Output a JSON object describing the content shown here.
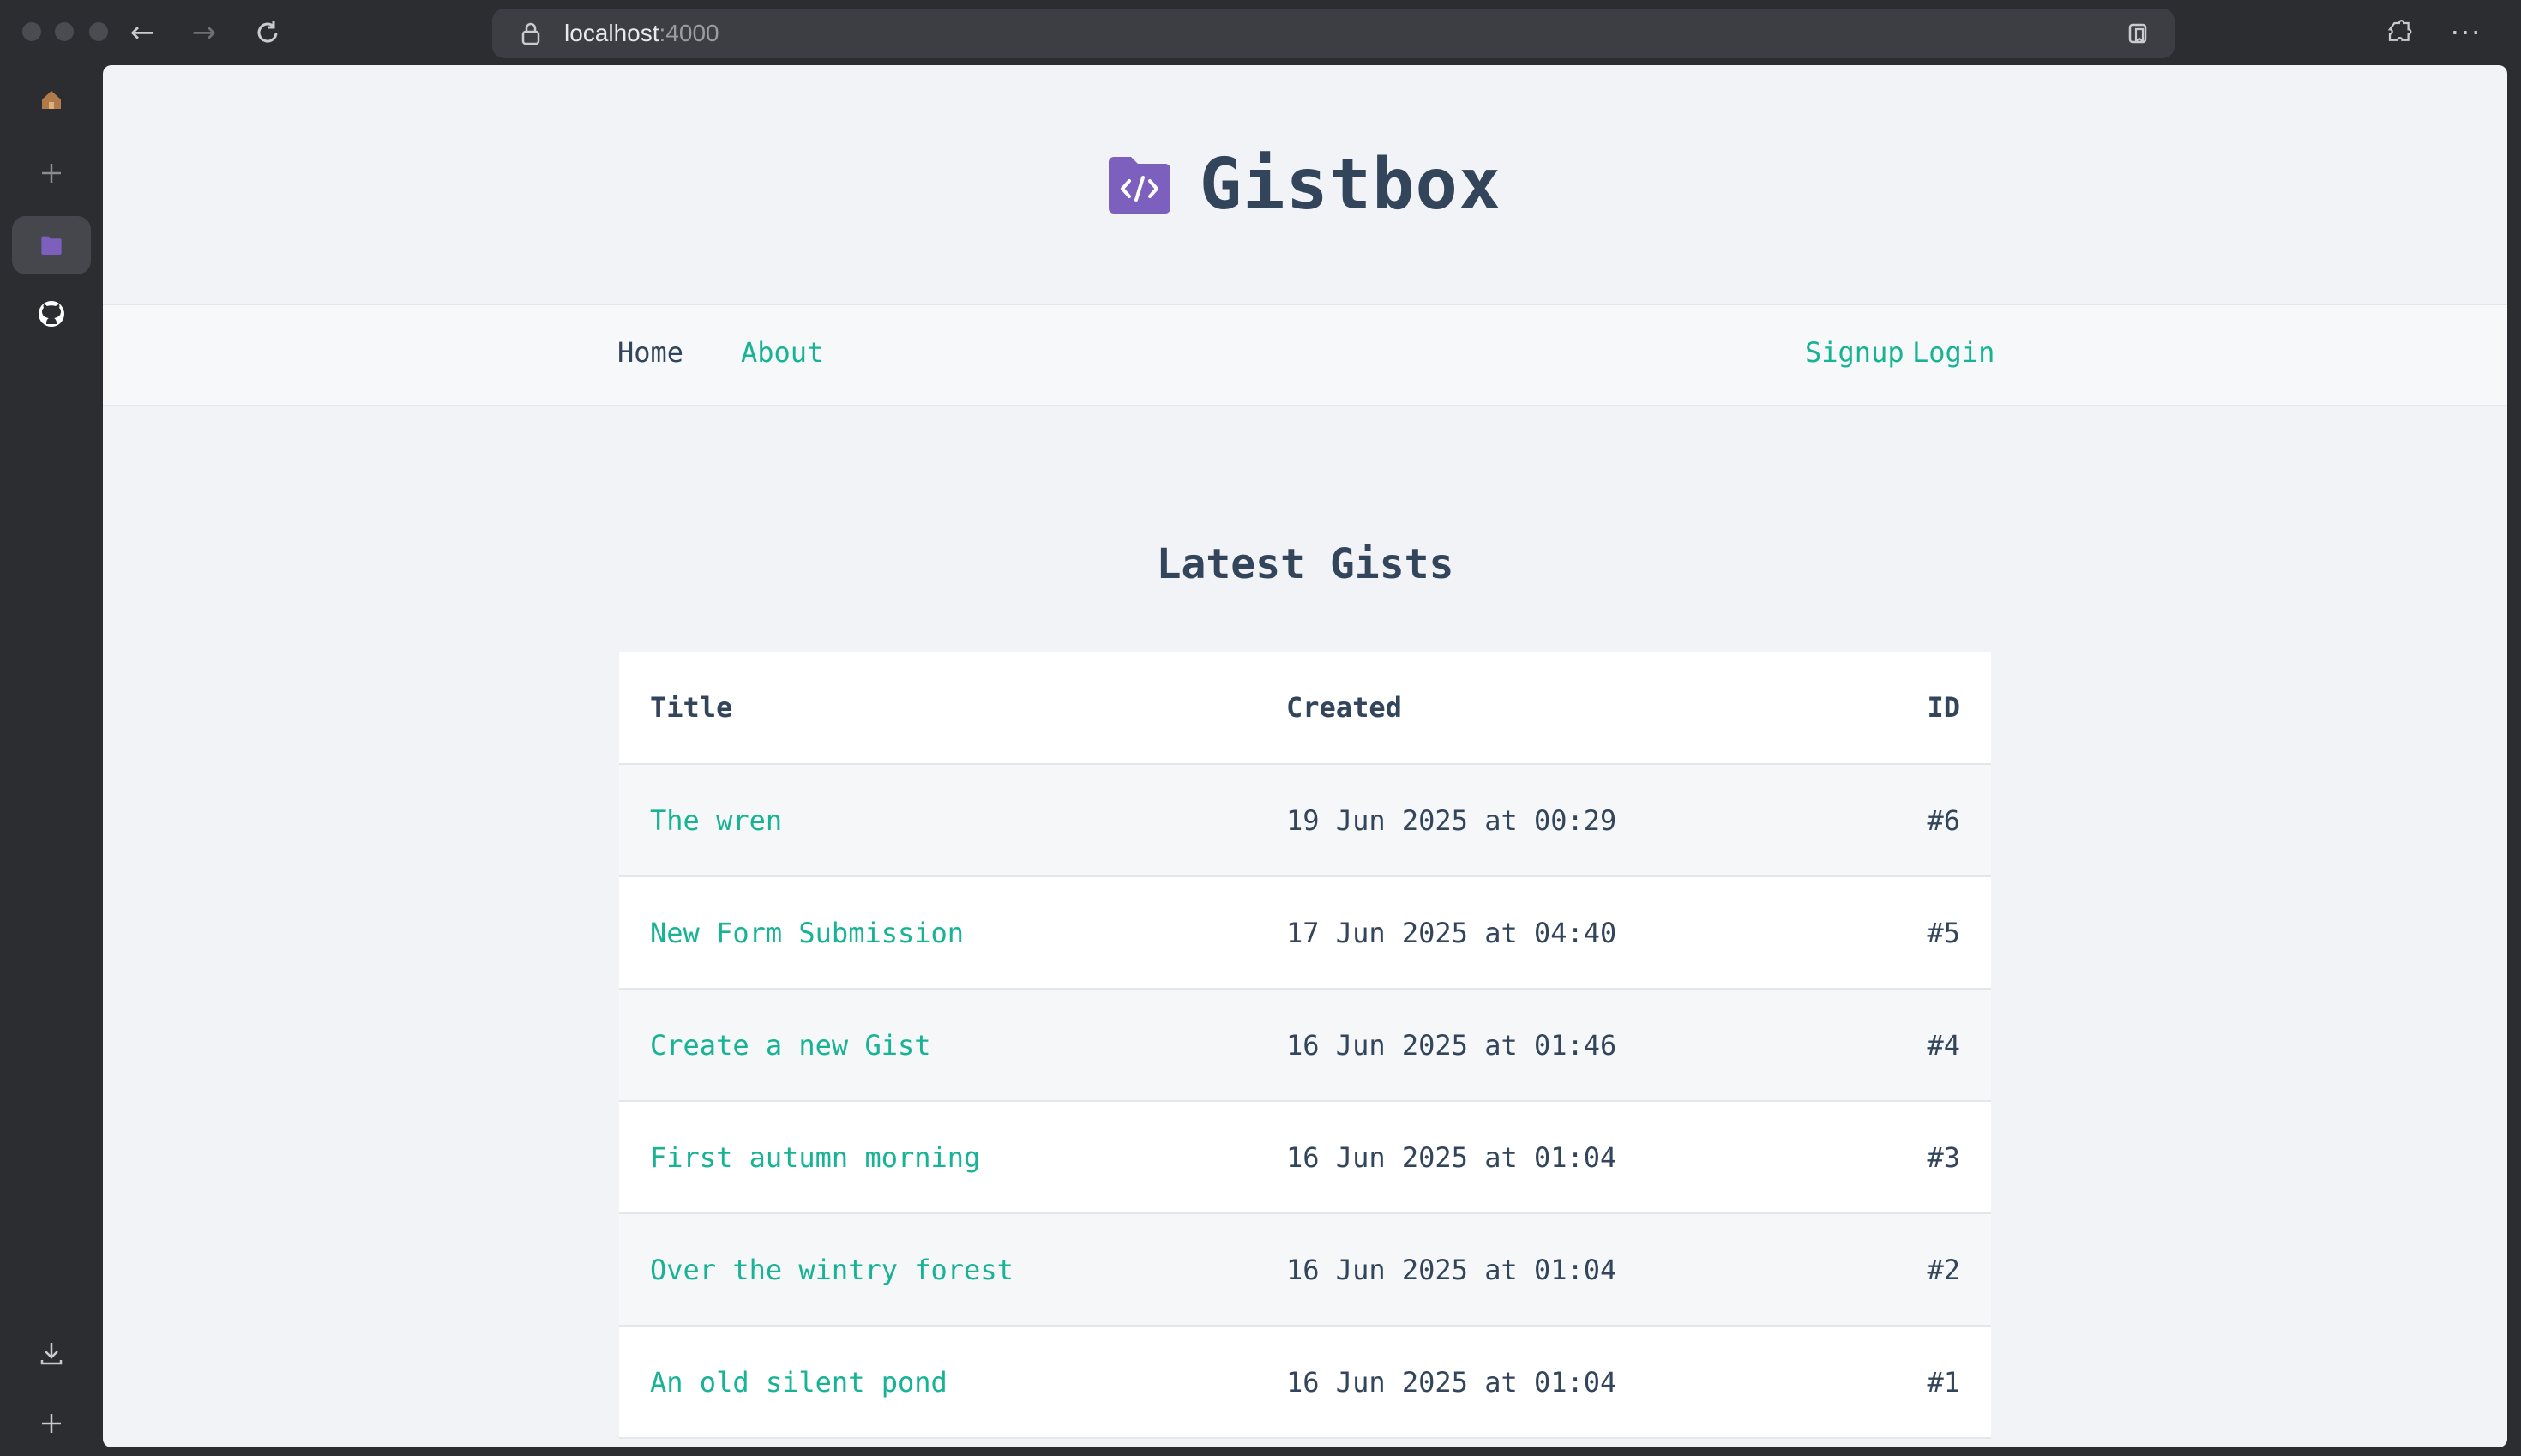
{
  "browser": {
    "url_host": "localhost",
    "url_port": ":4000",
    "icons": [
      "back-arrow-icon",
      "forward-arrow-icon",
      "reload-icon",
      "lock-icon",
      "reader-icon",
      "extensions-icon",
      "more-icon"
    ]
  },
  "sidebar": {
    "icons": [
      "home-icon",
      "new-tab-icon",
      "gistbox-tab-icon",
      "github-icon",
      "download-icon",
      "add-icon"
    ]
  },
  "site": {
    "title": "Gistbox",
    "logo_color": "#7d5fbd",
    "accent_color": "#17b394"
  },
  "nav": {
    "home": "Home",
    "about": "About",
    "signup": "Signup",
    "login": "Login"
  },
  "main": {
    "heading": "Latest Gists",
    "columns": {
      "title": "Title",
      "created": "Created",
      "id": "ID"
    },
    "rows": [
      {
        "title": "The wren",
        "created": "19 Jun 2025 at 00:29",
        "id": "#6"
      },
      {
        "title": "New Form Submission",
        "created": "17 Jun 2025 at 04:40",
        "id": "#5"
      },
      {
        "title": "Create a new Gist",
        "created": "16 Jun 2025 at 01:46",
        "id": "#4"
      },
      {
        "title": "First autumn morning",
        "created": "16 Jun 2025 at 01:04",
        "id": "#3"
      },
      {
        "title": "Over the wintry forest",
        "created": "16 Jun 2025 at 01:04",
        "id": "#2"
      },
      {
        "title": "An old silent pond",
        "created": "16 Jun 2025 at 01:04",
        "id": "#1"
      }
    ]
  }
}
